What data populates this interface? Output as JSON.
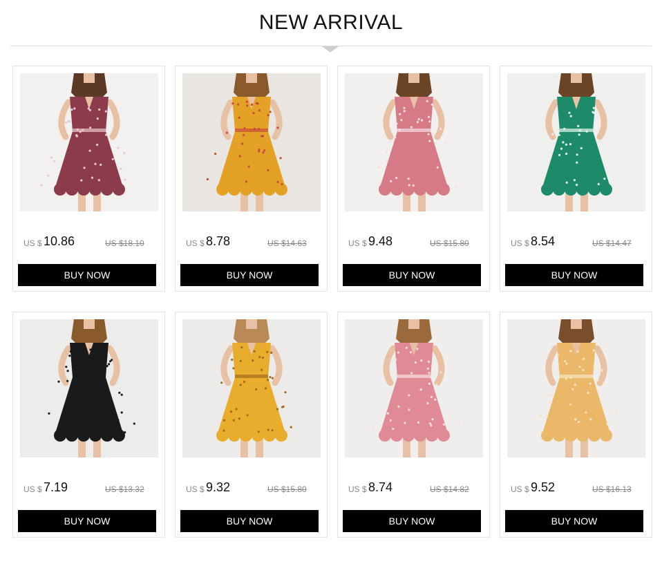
{
  "header": {
    "title": "NEW ARRIVAL"
  },
  "products": [
    {
      "image": "dress-burgundy-floral-photo",
      "bg": "#f2f1ef",
      "dress": "#8c3b4a",
      "dots": "#e9c9cf",
      "hair": "#5a3a24",
      "skin": "#e8c1a5",
      "currency": "US $",
      "price": "10.86",
      "old_price": "US $18.10",
      "button": "BUY NOW"
    },
    {
      "image": "dress-mustard-floral-wrap-photo",
      "bg": "#e9e6e2",
      "dress": "#e3a126",
      "dots": "#c94a3a",
      "hair": "#8a5a2c",
      "skin": "#e8c1a5",
      "currency": "US $",
      "price": "8.78",
      "old_price": "US $14.63",
      "button": "BUY NOW"
    },
    {
      "image": "dress-pink-polka-dot-photo",
      "bg": "#f1f0ee",
      "dress": "#d67a86",
      "dots": "#f6dfe2",
      "hair": "#6b4426",
      "skin": "#e8c1a5",
      "currency": "US $",
      "price": "9.48",
      "old_price": "US $15.80",
      "button": "BUY NOW"
    },
    {
      "image": "dress-green-polka-dot-photo",
      "bg": "#efefed",
      "dress": "#1d8a6a",
      "dots": "#e6f4ee",
      "hair": "#6b4426",
      "skin": "#e8c1a5",
      "currency": "US $",
      "price": "8.54",
      "old_price": "US $14.47",
      "button": "BUY NOW"
    },
    {
      "image": "dress-black-open-back-photo",
      "bg": "#ececea",
      "dress": "#1a1a1a",
      "dots": "#1a1a1a",
      "hair": "#8a5a2c",
      "skin": "#e8c1a5",
      "currency": "US $",
      "price": "7.19",
      "old_price": "US $13.32",
      "button": "BUY NOW"
    },
    {
      "image": "dress-yellow-floral-ruffle-photo",
      "bg": "#ecebe9",
      "dress": "#e8ad2c",
      "dots": "#a36b1d",
      "hair": "#b98a55",
      "skin": "#e8c1a5",
      "currency": "US $",
      "price": "9.32",
      "old_price": "US $15.80",
      "button": "BUY NOW"
    },
    {
      "image": "dress-pink-button-front-photo",
      "bg": "#efeeec",
      "dress": "#e08a95",
      "dots": "#f6dfe2",
      "hair": "#9a6a3c",
      "skin": "#e8c1a5",
      "currency": "US $",
      "price": "8.74",
      "old_price": "US $14.82",
      "button": "BUY NOW"
    },
    {
      "image": "dress-apricot-floral-button-photo",
      "bg": "#efeeec",
      "dress": "#eab868",
      "dots": "#f7e6c3",
      "hair": "#7a4e2c",
      "skin": "#e8c1a5",
      "currency": "US $",
      "price": "9.52",
      "old_price": "US $16.13",
      "button": "BUY NOW"
    }
  ]
}
